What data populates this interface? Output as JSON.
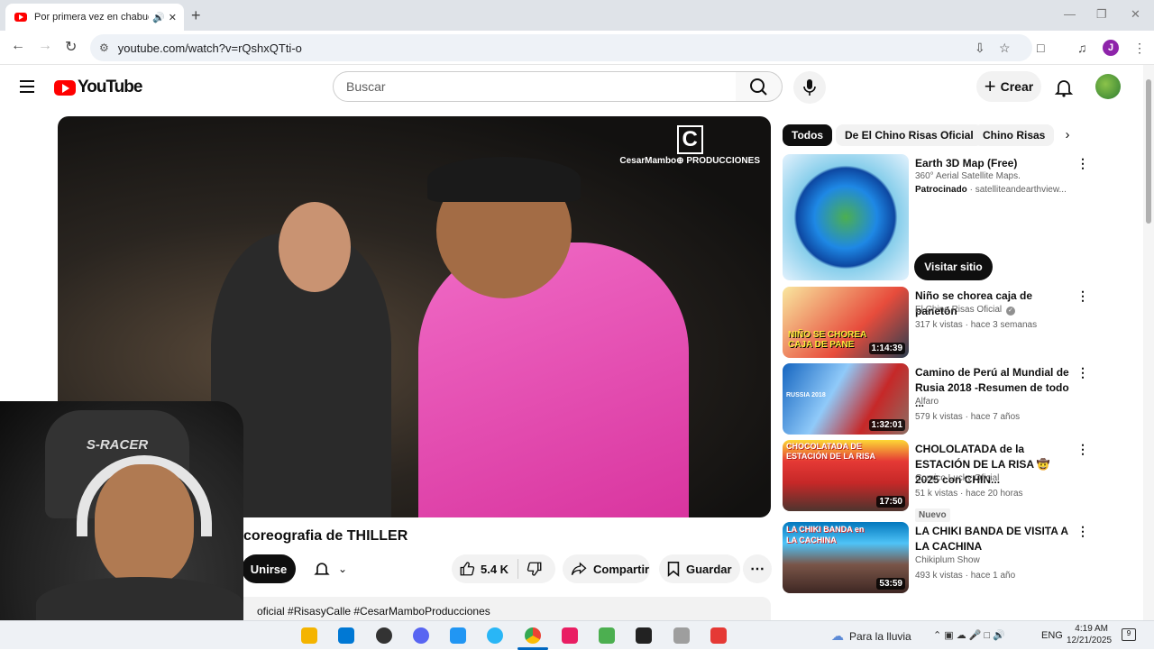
{
  "browser": {
    "tab_title": "Por primera vez en chabuca",
    "url": "youtube.com/watch?v=rQshxQTti-o",
    "profile_initial": "J"
  },
  "header": {
    "logo_text": "YouTube",
    "search_placeholder": "Buscar",
    "create_label": "Crear"
  },
  "video": {
    "watermark_mark": "C",
    "watermark_text": "CesarMambo⊕ PRODUCCIONES",
    "webcam_chair_text": "S-RACER",
    "title": "ca la coreografia de THILLER",
    "join_label": "Unirse",
    "likes": "5.4 K",
    "share_label": "Compartir",
    "save_label": "Guardar",
    "description_snippet": "oficial #RisasyCalle #CesarMamboProducciones"
  },
  "chips": [
    "Todos",
    "De El Chino Risas Oficial",
    "Chino Risas"
  ],
  "recommendations": [
    {
      "title": "Earth 3D Map (Free)",
      "subtitle": "360° Aerial Satellite Maps.",
      "sponsored": "Patrocinado",
      "domain": "satelliteandearthview...",
      "cta": "Visitar sitio"
    },
    {
      "title": "Niño se chorea caja de panetón",
      "channel": "El Chino Risas Oficial",
      "stats": "317 k vistas · hace 3 semanas",
      "duration": "1:14:39",
      "thumb_text": "NIÑO SE CHOREA CAJA DE PANE"
    },
    {
      "title": "Camino de Perú al Mundial de Rusia 2018 -Resumen de todo ...",
      "channel": "Alfaro",
      "stats": "579 k vistas · hace 7 años",
      "duration": "1:32:01",
      "thumb_text": "RUSSIA 2018"
    },
    {
      "title": "CHOLOLATADA de la ESTACIÓN DE LA RISA 🤠 2025 con CHIN...",
      "channel": "Comico Lucky Oficial",
      "stats": "51 k vistas · hace 20 horas",
      "badge": "Nuevo",
      "duration": "17:50",
      "thumb_text": "CHOCOLATADA DE ESTACIÓN DE LA RISA"
    },
    {
      "title": "LA CHIKI BANDA DE VISITA A LA CACHINA",
      "channel": "Chikiplum Show",
      "stats": "493 k vistas · hace 1 año",
      "duration": "53:59",
      "thumb_text": "LA CHIKI BANDA en LA CACHINA"
    }
  ],
  "taskbar": {
    "weather": "Para la lluvia",
    "lang": "ENG",
    "time": "4:19 AM",
    "date": "12/21/2025",
    "notif_count": "9"
  },
  "colors": {
    "brand_red": "#ff0000",
    "chip_active_bg": "#0f0f0f",
    "pink_hoodie": "#e84fb5"
  }
}
